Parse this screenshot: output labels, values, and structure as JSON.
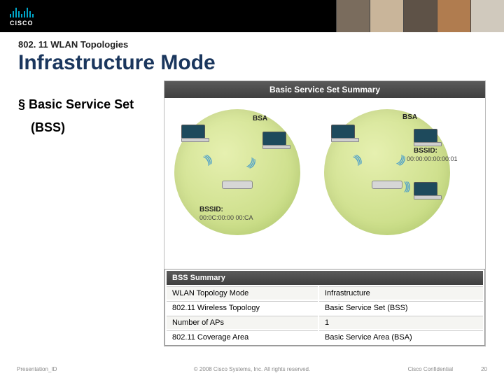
{
  "brand": "CISCO",
  "pretitle": "802. 11 WLAN Topologies",
  "title": "Infrastructure Mode",
  "bullet_main": "Basic Service Set",
  "bullet_sub": "(BSS)",
  "figure_title": "Basic Service Set Summary",
  "labels": {
    "bsa_left": "BSA",
    "bsa_right": "BSA",
    "bssid_label_l": "BSSID:",
    "bssid_val_l": "00:0C:00:00 00:CA",
    "bssid_label_r": "BSSID:",
    "bssid_val_r": "00:00:00:00:00:01"
  },
  "summary_header": "BSS Summary",
  "summary_rows": [
    {
      "k": "WLAN Topology Mode",
      "v": "Infrastructure"
    },
    {
      "k": "802.11 Wireless Topology",
      "v": "Basic Service Set (BSS)"
    },
    {
      "k": "Number of APs",
      "v": "1"
    },
    {
      "k": "802.11 Coverage Area",
      "v": "Basic Service Area (BSA)"
    }
  ],
  "footer": {
    "left": "Presentation_ID",
    "center": "© 2008 Cisco Systems, Inc. All rights reserved.",
    "conf": "Cisco Confidential",
    "page": "20"
  }
}
